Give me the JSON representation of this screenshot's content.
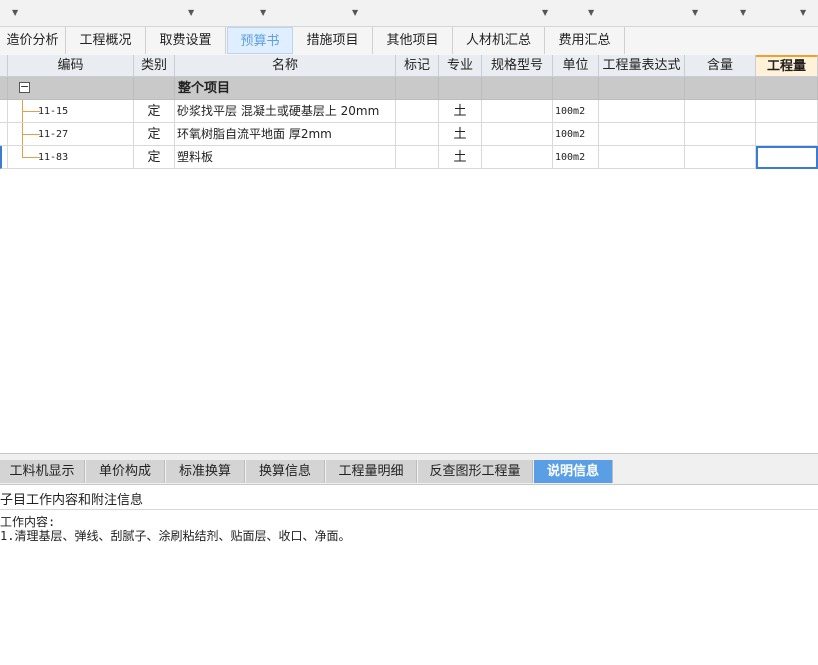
{
  "top_tabs": [
    {
      "label": "造价分析",
      "active": false
    },
    {
      "label": "工程概况",
      "active": false
    },
    {
      "label": "取费设置",
      "active": false
    },
    {
      "label": "预算书",
      "active": true
    },
    {
      "label": "措施项目",
      "active": false
    },
    {
      "label": "其他项目",
      "active": false
    },
    {
      "label": "人材机汇总",
      "active": false
    },
    {
      "label": "费用汇总",
      "active": false
    }
  ],
  "grid": {
    "columns": [
      "编码",
      "类别",
      "名称",
      "标记",
      "专业",
      "规格型号",
      "单位",
      "工程量表达式",
      "含量",
      "工程量"
    ],
    "group_row": {
      "expander": "−",
      "name": "整个项目"
    },
    "rows": [
      {
        "code": "11-15",
        "type": "定",
        "name": "砂浆找平层 混凝土或硬基层上 20mm",
        "mark": "",
        "major": "土",
        "spec": "",
        "unit": "100m2",
        "expr": "",
        "content": "",
        "qty": ""
      },
      {
        "code": "11-27",
        "type": "定",
        "name": "环氧树脂自流平地面 厚2mm",
        "mark": "",
        "major": "土",
        "spec": "",
        "unit": "100m2",
        "expr": "",
        "content": "",
        "qty": ""
      },
      {
        "code": "11-83",
        "type": "定",
        "name": "塑料板",
        "mark": "",
        "major": "土",
        "spec": "",
        "unit": "100m2",
        "expr": "",
        "content": "",
        "qty": ""
      }
    ]
  },
  "bottom_tabs": [
    {
      "label": "工料机显示",
      "active": false
    },
    {
      "label": "单价构成",
      "active": false
    },
    {
      "label": "标准换算",
      "active": false
    },
    {
      "label": "换算信息",
      "active": false
    },
    {
      "label": "工程量明细",
      "active": false
    },
    {
      "label": "反查图形工程量",
      "active": false
    },
    {
      "label": "说明信息",
      "active": true
    }
  ],
  "info_panel": {
    "title": "子目工作内容和附注信息",
    "lines": [
      "工作内容:",
      "1.清理基层、弹线、刮腻子、涂刷粘结剂、贴面层、收口、净面。"
    ]
  },
  "colors": {
    "active_tab": "#5a9ee6",
    "group_row": "#c9c9c9",
    "tree_line": "#e2a04a",
    "highlight_header": "#f0a030"
  },
  "icons": {
    "ribbon_arrow": "chevron-down-icon",
    "expander": "collapse-icon"
  }
}
